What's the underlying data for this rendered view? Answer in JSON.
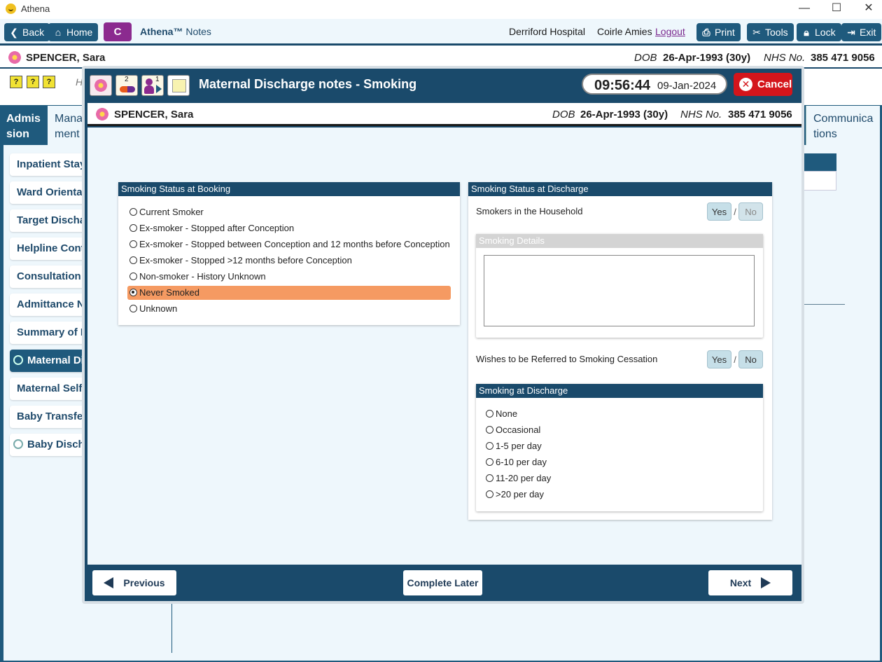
{
  "window": {
    "title": "Athena",
    "minimize": "—",
    "maximize": "☐",
    "close": "✕"
  },
  "toolbar": {
    "back": "Back",
    "home": "Home",
    "c_button": "C",
    "brand_name": "Athena™",
    "brand_suffix": "Notes",
    "hospital": "Derriford Hospital",
    "user": "Coirle Amies",
    "logout": "Logout",
    "print": "Print",
    "tools": "Tools",
    "lock": "Lock",
    "exit": "Exit"
  },
  "patient": {
    "name": "SPENCER, Sara",
    "dob_label": "DOB",
    "dob": "26-Apr-1993 (30y)",
    "nhs_label": "NHS No.",
    "nhs": "385 471 9056"
  },
  "background": {
    "tabs": {
      "admission": "Admis sion",
      "management": "Mana ment",
      "communications": "Communica tions"
    },
    "obscured_text": "H",
    "sidebar": [
      {
        "label": "Inpatient Stay",
        "active": false,
        "circle": false
      },
      {
        "label": "Ward Orientat",
        "active": false,
        "circle": false
      },
      {
        "label": "Target Dischar",
        "active": false,
        "circle": false
      },
      {
        "label": "Helpline Cont",
        "active": false,
        "circle": false
      },
      {
        "label": "Consultation I",
        "active": false,
        "circle": false
      },
      {
        "label": "Admittance N",
        "active": false,
        "circle": false
      },
      {
        "label": "Summary of P",
        "active": false,
        "circle": false
      },
      {
        "label": "Maternal Di",
        "active": true,
        "circle": true
      },
      {
        "label": "Maternal Self",
        "active": false,
        "circle": false
      },
      {
        "label": "Baby Transfer",
        "active": false,
        "circle": false
      },
      {
        "label": "Baby Discha",
        "active": false,
        "circle": true
      }
    ]
  },
  "modal": {
    "title": "Maternal Discharge notes - Smoking",
    "time": "09:56:44",
    "date": "09-Jan-2024",
    "cancel": "Cancel",
    "icon_badge_2": "2",
    "icon_badge_1": "1",
    "booking": {
      "header": "Smoking Status at Booking",
      "options": [
        {
          "label": "Current Smoker",
          "selected": false
        },
        {
          "label": "Ex-smoker - Stopped after Conception",
          "selected": false
        },
        {
          "label": "Ex-smoker - Stopped between Conception and 12 months before Conception",
          "selected": false
        },
        {
          "label": "Ex-smoker - Stopped >12 months before Conception",
          "selected": false
        },
        {
          "label": "Non-smoker - History Unknown",
          "selected": false
        },
        {
          "label": "Never Smoked",
          "selected": true
        },
        {
          "label": "Unknown",
          "selected": false
        }
      ]
    },
    "discharge": {
      "header": "Smoking Status at Discharge",
      "household_label": "Smokers in the Household",
      "yes": "Yes",
      "no": "No",
      "slash": "/",
      "details_header": "Smoking Details",
      "details_value": "",
      "referral_label": "Wishes to be Referred to Smoking Cessation",
      "at_discharge": {
        "header": "Smoking at Discharge",
        "options": [
          {
            "label": "None",
            "selected": false
          },
          {
            "label": "Occasional",
            "selected": false
          },
          {
            "label": "1-5 per day",
            "selected": false
          },
          {
            "label": "6-10 per day",
            "selected": false
          },
          {
            "label": "11-20 per day",
            "selected": false
          },
          {
            "label": ">20 per day",
            "selected": false
          }
        ]
      }
    },
    "footer": {
      "previous": "Previous",
      "complete_later": "Complete Later",
      "next": "Next"
    }
  },
  "colors": {
    "primary": "#1a4a6b",
    "accent_purple": "#8b2a8f",
    "cancel_red": "#d4151b",
    "selected_row": "#f59a62",
    "body_bg": "#eef7fc"
  }
}
